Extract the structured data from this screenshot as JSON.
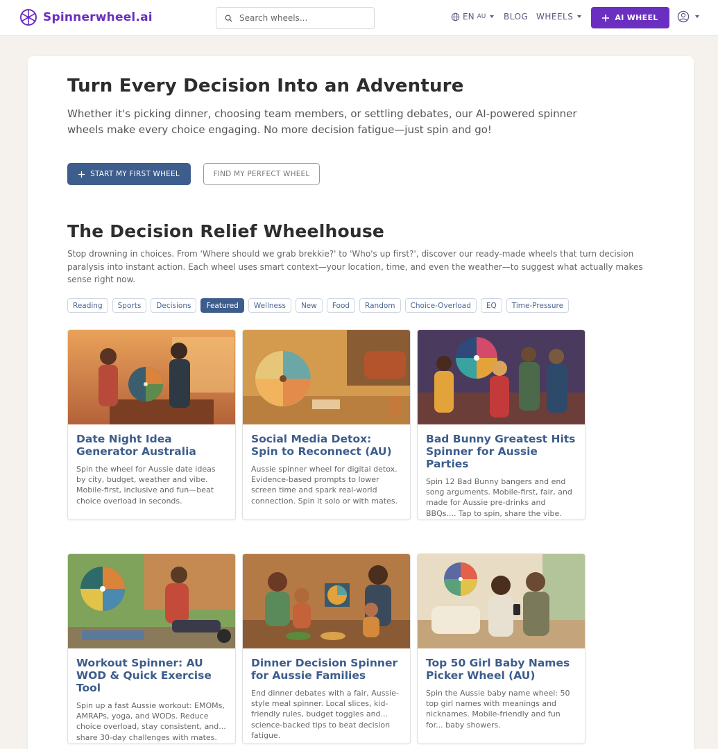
{
  "header": {
    "logo_text": "Spinnerwheel.ai",
    "search_placeholder": "Search wheels...",
    "lang": "EN",
    "lang_region": "AU",
    "blog": "BLOG",
    "wheels": "WHEELS",
    "ai_button": "AI WHEEL"
  },
  "hero": {
    "title": "Turn Every Decision Into an Adventure",
    "subtitle": "Whether it's picking dinner, choosing team members, or settling debates, our AI-powered spinner wheels make every choice engaging. No more decision fatigue—just spin and go!",
    "primary_button": "START MY FIRST WHEEL",
    "secondary_button": "FIND MY PERFECT WHEEL"
  },
  "section": {
    "title": "The Decision Relief Wheelhouse",
    "description": "Stop drowning in choices. From 'Where should we grab brekkie?' to 'Who's up first?', discover our ready-made wheels that turn decision paralysis into instant action. Each wheel uses smart context—your location, time, and even the weather—to suggest what actually makes sense right now."
  },
  "tags": [
    "Reading",
    "Sports",
    "Decisions",
    "Featured",
    "Wellness",
    "New",
    "Food",
    "Random",
    "Choice-Overload",
    "EQ",
    "Time-Pressure"
  ],
  "active_tag": "Featured",
  "cards": [
    {
      "title": "Date Night Idea Generator Australia",
      "description": "Spin the wheel for Aussie date ideas by city, budget, weather and vibe. Mobile-first, inclusive and fun—beat choice overload in seconds."
    },
    {
      "title": "Social Media Detox: Spin to Reconnect (AU)",
      "description": "Aussie spinner wheel for digital detox. Evidence-based prompts to lower screen time and spark real-world connection. Spin it solo or with mates."
    },
    {
      "title": "Bad Bunny Greatest Hits Spinner for Aussie Parties",
      "description": "Spin 12 Bad Bunny bangers and end song arguments. Mobile-first, fair, and made for Aussie pre-drinks and BBQs.... Tap to spin, share the vibe."
    },
    {
      "title": "Workout Spinner: AU WOD & Quick Exercise Tool",
      "description": "Spin up a fast Aussie workout: EMOMs, AMRAPs, yoga, and WODs. Reduce choice overload, stay consistent, and... share 30-day challenges with mates."
    },
    {
      "title": "Dinner Decision Spinner for Aussie Families",
      "description": "End dinner debates with a fair, Aussie-style meal spinner. Local slices, kid-friendly rules, budget toggles and... science-backed tips to beat decision fatigue."
    },
    {
      "title": "Top 50 Girl Baby Names Picker Wheel (AU)",
      "description": "Spin the Aussie baby name wheel: 50 top girl names with meanings and nicknames. Mobile-friendly and fun for... baby showers."
    }
  ],
  "colors": {
    "brand": "#6a2fc0",
    "primary": "#3d5d8c",
    "background": "#f5f1ec"
  }
}
